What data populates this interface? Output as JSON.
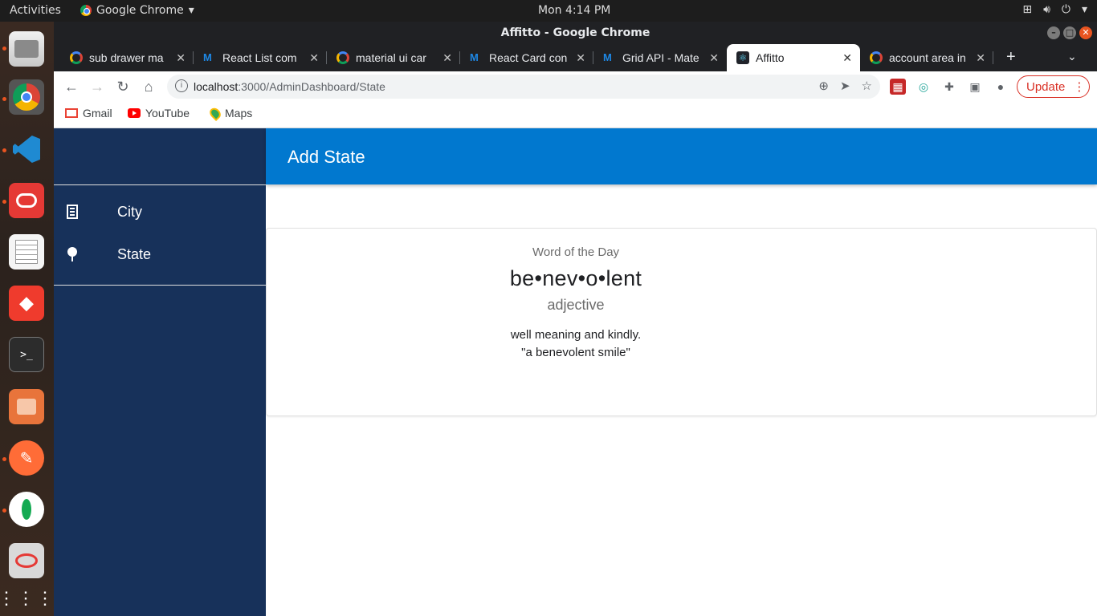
{
  "os": {
    "activities": "Activities",
    "app_name": "Google Chrome",
    "clock": "Mon  4:14 PM"
  },
  "window": {
    "title": "Affitto - Google Chrome"
  },
  "tabs": [
    {
      "label": "sub drawer ma",
      "favicon": "google-icon"
    },
    {
      "label": "React List com",
      "favicon": "mui-icon"
    },
    {
      "label": "material ui car",
      "favicon": "google-icon"
    },
    {
      "label": "React Card con",
      "favicon": "mui-icon"
    },
    {
      "label": "Grid API - Mate",
      "favicon": "mui-icon"
    },
    {
      "label": "Affitto",
      "favicon": "react-icon",
      "active": true
    },
    {
      "label": "account area in",
      "favicon": "google-icon"
    }
  ],
  "toolbar": {
    "url_host": "localhost",
    "url_path": ":3000/AdminDashboard/State",
    "update_label": "Update"
  },
  "bookmarks": [
    {
      "label": "Gmail",
      "icon": "gmail-icon"
    },
    {
      "label": "YouTube",
      "icon": "youtube-icon"
    },
    {
      "label": "Maps",
      "icon": "maps-icon"
    }
  ],
  "drawer": {
    "items": [
      {
        "label": "City",
        "icon": "building-icon"
      },
      {
        "label": "State",
        "icon": "pin-icon"
      }
    ]
  },
  "appbar": {
    "title": "Add State"
  },
  "card": {
    "overline": "Word of the Day",
    "word": "be•nev•o•lent",
    "part_of_speech": "adjective",
    "definition": "well meaning and kindly.",
    "example": "\"a benevolent smile\""
  },
  "colors": {
    "drawer_bg": "#17315a",
    "appbar_bg": "#0178cf",
    "update_red": "#d93025"
  }
}
